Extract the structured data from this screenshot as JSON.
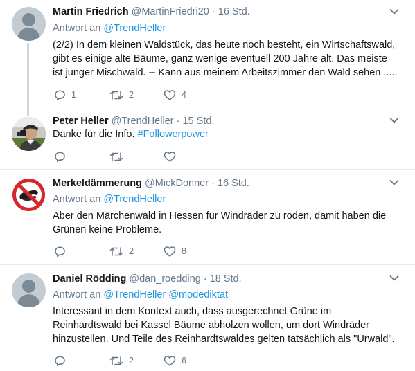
{
  "tweets": [
    {
      "name": "Martin Friedrich",
      "handle": "@MartinFriedri20",
      "dot": "·",
      "time": "16 Std.",
      "reply_prefix": "Antwort an",
      "reply_to": "@TrendHeller",
      "text": "(2/2) In dem kleinen Waldstück, das heute noch besteht, ein Wirtschaftswald, gibt es einige alte Bäume, ganz wenige eventuell 200 Jahre alt. Das meiste ist junger Mischwald. -- Kann aus meinem Arbeitszimmer den Wald sehen .....",
      "replies": "1",
      "retweets": "2",
      "likes": "4",
      "avatar": "default-avatar"
    },
    {
      "name": "Peter Heller",
      "handle": "@TrendHeller",
      "dot": "·",
      "time": "15 Std.",
      "text_plain": "Danke für die Info. ",
      "hashtag": "#Followerpower",
      "avatar": "photo-avatar"
    },
    {
      "name": "Merkeldämmerung",
      "handle": "@MickDonner",
      "dot": "·",
      "time": "16 Std.",
      "reply_prefix": "Antwort an",
      "reply_to": "@TrendHeller",
      "text": "Aber den Märchenwald in Hessen für Windräder zu roden, damit haben die Grünen keine Probleme.",
      "retweets": "2",
      "likes": "8",
      "avatar": "prohibition-sign-avatar"
    },
    {
      "name": "Daniel Rödding",
      "handle": "@dan_roedding",
      "dot": "·",
      "time": "18 Std.",
      "reply_prefix": "Antwort an",
      "reply_to": "@TrendHeller",
      "reply_to_2": "@modediktat",
      "text": "Interessant in dem Kontext auch, dass ausgerechnet Grüne im Reinhardtswald bei Kassel Bäume abholzen wollen, um dort Windräder hinzustellen. Und Teile des Reinhardtswaldes gelten tatsächlich als \"Urwald\".",
      "retweets": "2",
      "likes": "6",
      "avatar": "default-avatar"
    }
  ],
  "colors": {
    "link": "#1b95e0",
    "muted": "#657786",
    "divider": "#e6ecf0",
    "prohibition": "#d4282d"
  }
}
